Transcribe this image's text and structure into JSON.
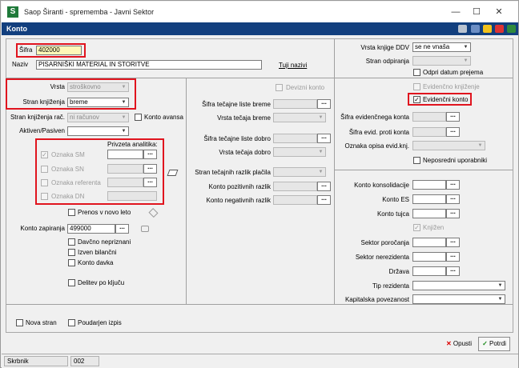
{
  "window": {
    "title": "Saop Širanti - sprememba - Javni Sektor",
    "app_icon": "S"
  },
  "header": {
    "title": "Konto"
  },
  "left": {
    "sifra_label": "Šifra",
    "sifra_value": "402000",
    "naziv_label": "Naziv",
    "naziv_value": "PISARNIŠKI MATERIAL IN STORITVE",
    "tuji_nazivi": "Tuji nazivi",
    "vrsta_label": "Vrsta",
    "vrsta_value": "stroškovno",
    "stran_knjizenja_label": "Stran knjiženja",
    "stran_knjizenja_value": "breme",
    "stran_knjizenja_rac_label": "Stran knjiženja rač.",
    "stran_knjizenja_rac_value": "ni računov",
    "konto_avansa": "Konto avansa",
    "aktiven_label": "Aktiven/Pasiven",
    "privzeta_analitika": "Privzeta analitika:",
    "oznaka_sm": "Oznaka SM",
    "oznaka_sn": "Oznaka SN",
    "oznaka_referenta": "Oznaka referenta",
    "oznaka_dn": "Oznaka DN",
    "prenos_v_novo_leto": "Prenos v novo leto",
    "konto_zapiranja_label": "Konto zapiranja",
    "konto_zapiranja_value": "499000",
    "davcno_nepriznani": "Davčno nepriznani",
    "izven_bilancni": "Izven bilančni",
    "konto_davka": "Konto davka",
    "delitev_po_kljucu": "Delitev po ključu",
    "nova_stran": "Nova stran",
    "poudarjen_izpis": "Poudarjen izpis"
  },
  "middle": {
    "devizni_konto": "Devizni konto",
    "sifra_tecajne_liste_breme": "Šifra tečajne liste breme",
    "vrsta_tecaja_breme": "Vrsta tečaja breme",
    "sifra_tecajne_liste_dobro": "Šifra tečajne liste dobro",
    "vrsta_tecaja_dobro": "Vrsta tečaja dobro",
    "stran_tecajnih_razlik": "Stran tečajnih razlik plačila",
    "konto_pozitivnih_razlik": "Konto pozitivnih razlik",
    "konto_negativnih_razlik": "Konto negativnih razlik"
  },
  "right": {
    "vrsta_knjige_ddv_label": "Vrsta knjige DDV",
    "vrsta_knjige_ddv_value": "se ne vnaša",
    "stran_odpiranja": "Stran odpiranja",
    "odpri_datum_prejema": "Odpri datum prejema",
    "evidencno_knjizenje": "Evidenčno knjiženje",
    "evidencni_konto": "Evidenčni konto",
    "sifra_evidencnega_konta": "Šifra evidenčnega konta",
    "sifra_evid_proti_konta": "Šifra evid. proti konta",
    "oznaka_opisa_evid_knj": "Oznaka opisa evid.knj.",
    "neposredni_uporabniki": "Neposredni uporabniki",
    "konto_konsolidacije": "Konto konsolidacije",
    "konto_es": "Konto ES",
    "konto_tujca": "Konto tujca",
    "knjizen": "Knjižen",
    "sektor_porocanja": "Sektor poročanja",
    "sektor_nerezidenta": "Sektor nerezidenta",
    "drzava": "Država",
    "tip_rezidenta": "Tip rezidenta",
    "kapitalska_povezanost": "Kapitalska povezanost"
  },
  "buttons": {
    "opusti": "Opusti",
    "potrdi": "Potrdi"
  },
  "status": {
    "user": "Skrbnik",
    "code": "002"
  },
  "common": {
    "dots": "...",
    "dd": "▼"
  },
  "colors": {
    "header": "#123f7e",
    "highlight": "#e0141e",
    "sifra_bg": "#fff8b8"
  }
}
